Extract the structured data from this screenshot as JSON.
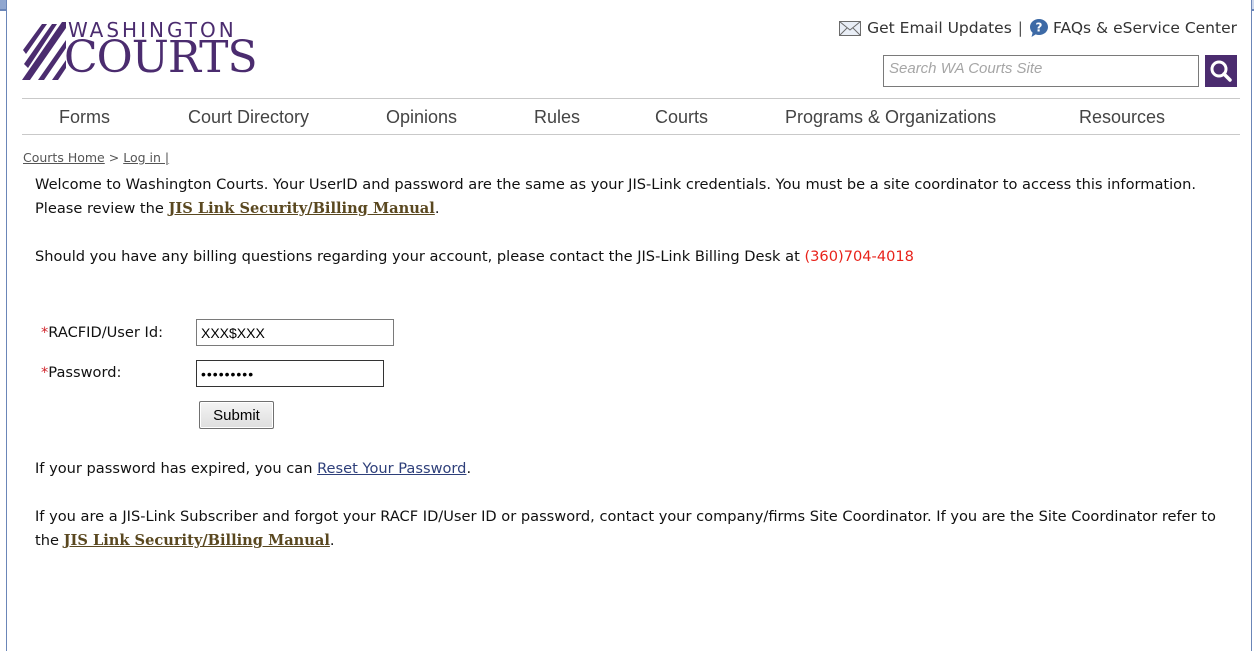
{
  "header": {
    "logo_line1": "WASHINGTON",
    "logo_line2": "COURTS",
    "email_updates": "Get Email Updates",
    "separator": "|",
    "faq_link": "FAQs & eService Center",
    "search_placeholder": "Search WA Courts Site"
  },
  "nav": {
    "items": [
      "Forms",
      "Court Directory",
      "Opinions",
      "Rules",
      "Courts",
      "Programs & Organizations",
      "Resources"
    ]
  },
  "breadcrumb": {
    "home": "Courts Home",
    "sep": ">",
    "current": "Log in |"
  },
  "intro": {
    "text1": "Welcome to Washington Courts. Your UserID and password are the same as your JIS-Link credentials. You must be a site coordinator to access this information. Please review the ",
    "manual_link": "JIS Link Security/Billing Manual",
    "text1_end": ".",
    "billing_text": "Should you have any billing questions regarding your account, please contact the JIS-Link Billing Desk at ",
    "phone": "(360)704-4018"
  },
  "form": {
    "required_mark": "*",
    "user_label": "RACFID/User Id:",
    "user_value": "XXX$XXX",
    "password_label": "Password:",
    "password_value": "•••••••••",
    "submit_label": "Submit"
  },
  "help": {
    "reset_text": "If your password has expired, you can ",
    "reset_link": "Reset Your Password",
    "reset_end": ".",
    "forgot_text": "If you are a JIS-Link Subscriber and forgot your RACF ID/User ID or password, contact your company/firms Site Coordinator. If you are the Site Coordinator refer to the ",
    "manual_link": "JIS Link Security/Billing Manual",
    "forgot_end": "."
  },
  "colors": {
    "brand_purple": "#4b2c6f",
    "phone_red": "#e8221a",
    "manual_link": "#5a4820",
    "required_red": "#d0232a"
  }
}
